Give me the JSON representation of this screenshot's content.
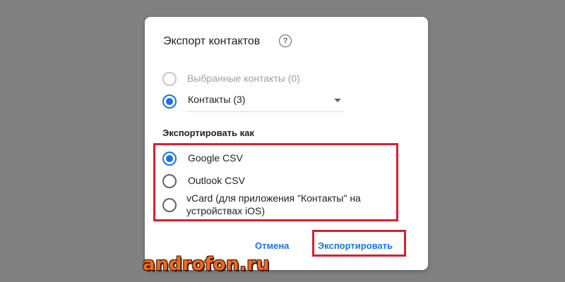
{
  "dialog": {
    "title": "Экспорт контактов",
    "help_icon": "help-circle-icon",
    "source_options": [
      {
        "label": "Выбранные контакты (0)",
        "checked": false,
        "disabled": true
      },
      {
        "label": "Контакты (3)",
        "checked": true,
        "disabled": false
      }
    ],
    "contacts_select": {
      "value": "Контакты (3)"
    },
    "export_as_heading": "Экспортировать как",
    "format_options": [
      {
        "label": "Google CSV",
        "checked": true
      },
      {
        "label": "Outlook CSV",
        "checked": false
      },
      {
        "label": "vCard (для приложения \"Контакты\" на устройствах iOS)",
        "checked": false
      }
    ],
    "buttons": {
      "cancel": "Отмена",
      "export": "Экспортировать"
    }
  },
  "watermark": "androfon.ru",
  "colors": {
    "background": "#808080",
    "accent": "#1a73e8",
    "highlight": "#d5212f",
    "watermark": "#f06a1d"
  }
}
